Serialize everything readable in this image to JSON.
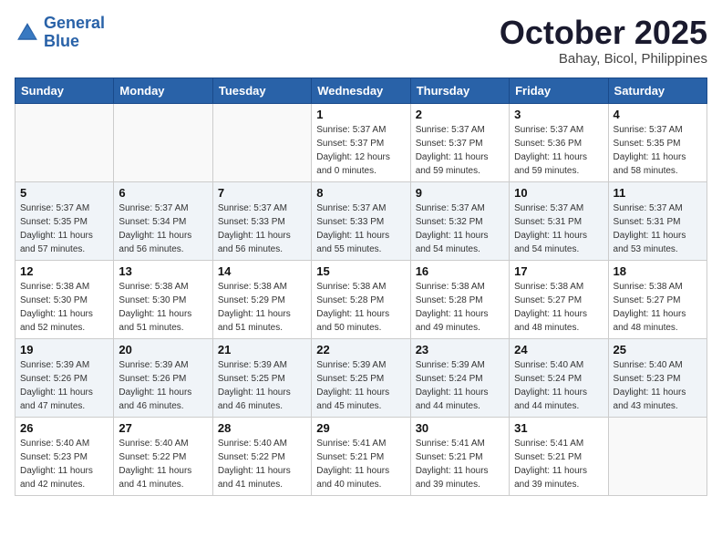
{
  "header": {
    "logo_line1": "General",
    "logo_line2": "Blue",
    "month": "October 2025",
    "location": "Bahay, Bicol, Philippines"
  },
  "weekdays": [
    "Sunday",
    "Monday",
    "Tuesday",
    "Wednesday",
    "Thursday",
    "Friday",
    "Saturday"
  ],
  "weeks": [
    [
      {
        "day": "",
        "sunrise": "",
        "sunset": "",
        "daylight": ""
      },
      {
        "day": "",
        "sunrise": "",
        "sunset": "",
        "daylight": ""
      },
      {
        "day": "",
        "sunrise": "",
        "sunset": "",
        "daylight": ""
      },
      {
        "day": "1",
        "sunrise": "Sunrise: 5:37 AM",
        "sunset": "Sunset: 5:37 PM",
        "daylight": "Daylight: 12 hours and 0 minutes."
      },
      {
        "day": "2",
        "sunrise": "Sunrise: 5:37 AM",
        "sunset": "Sunset: 5:37 PM",
        "daylight": "Daylight: 11 hours and 59 minutes."
      },
      {
        "day": "3",
        "sunrise": "Sunrise: 5:37 AM",
        "sunset": "Sunset: 5:36 PM",
        "daylight": "Daylight: 11 hours and 59 minutes."
      },
      {
        "day": "4",
        "sunrise": "Sunrise: 5:37 AM",
        "sunset": "Sunset: 5:35 PM",
        "daylight": "Daylight: 11 hours and 58 minutes."
      }
    ],
    [
      {
        "day": "5",
        "sunrise": "Sunrise: 5:37 AM",
        "sunset": "Sunset: 5:35 PM",
        "daylight": "Daylight: 11 hours and 57 minutes."
      },
      {
        "day": "6",
        "sunrise": "Sunrise: 5:37 AM",
        "sunset": "Sunset: 5:34 PM",
        "daylight": "Daylight: 11 hours and 56 minutes."
      },
      {
        "day": "7",
        "sunrise": "Sunrise: 5:37 AM",
        "sunset": "Sunset: 5:33 PM",
        "daylight": "Daylight: 11 hours and 56 minutes."
      },
      {
        "day": "8",
        "sunrise": "Sunrise: 5:37 AM",
        "sunset": "Sunset: 5:33 PM",
        "daylight": "Daylight: 11 hours and 55 minutes."
      },
      {
        "day": "9",
        "sunrise": "Sunrise: 5:37 AM",
        "sunset": "Sunset: 5:32 PM",
        "daylight": "Daylight: 11 hours and 54 minutes."
      },
      {
        "day": "10",
        "sunrise": "Sunrise: 5:37 AM",
        "sunset": "Sunset: 5:31 PM",
        "daylight": "Daylight: 11 hours and 54 minutes."
      },
      {
        "day": "11",
        "sunrise": "Sunrise: 5:37 AM",
        "sunset": "Sunset: 5:31 PM",
        "daylight": "Daylight: 11 hours and 53 minutes."
      }
    ],
    [
      {
        "day": "12",
        "sunrise": "Sunrise: 5:38 AM",
        "sunset": "Sunset: 5:30 PM",
        "daylight": "Daylight: 11 hours and 52 minutes."
      },
      {
        "day": "13",
        "sunrise": "Sunrise: 5:38 AM",
        "sunset": "Sunset: 5:30 PM",
        "daylight": "Daylight: 11 hours and 51 minutes."
      },
      {
        "day": "14",
        "sunrise": "Sunrise: 5:38 AM",
        "sunset": "Sunset: 5:29 PM",
        "daylight": "Daylight: 11 hours and 51 minutes."
      },
      {
        "day": "15",
        "sunrise": "Sunrise: 5:38 AM",
        "sunset": "Sunset: 5:28 PM",
        "daylight": "Daylight: 11 hours and 50 minutes."
      },
      {
        "day": "16",
        "sunrise": "Sunrise: 5:38 AM",
        "sunset": "Sunset: 5:28 PM",
        "daylight": "Daylight: 11 hours and 49 minutes."
      },
      {
        "day": "17",
        "sunrise": "Sunrise: 5:38 AM",
        "sunset": "Sunset: 5:27 PM",
        "daylight": "Daylight: 11 hours and 48 minutes."
      },
      {
        "day": "18",
        "sunrise": "Sunrise: 5:38 AM",
        "sunset": "Sunset: 5:27 PM",
        "daylight": "Daylight: 11 hours and 48 minutes."
      }
    ],
    [
      {
        "day": "19",
        "sunrise": "Sunrise: 5:39 AM",
        "sunset": "Sunset: 5:26 PM",
        "daylight": "Daylight: 11 hours and 47 minutes."
      },
      {
        "day": "20",
        "sunrise": "Sunrise: 5:39 AM",
        "sunset": "Sunset: 5:26 PM",
        "daylight": "Daylight: 11 hours and 46 minutes."
      },
      {
        "day": "21",
        "sunrise": "Sunrise: 5:39 AM",
        "sunset": "Sunset: 5:25 PM",
        "daylight": "Daylight: 11 hours and 46 minutes."
      },
      {
        "day": "22",
        "sunrise": "Sunrise: 5:39 AM",
        "sunset": "Sunset: 5:25 PM",
        "daylight": "Daylight: 11 hours and 45 minutes."
      },
      {
        "day": "23",
        "sunrise": "Sunrise: 5:39 AM",
        "sunset": "Sunset: 5:24 PM",
        "daylight": "Daylight: 11 hours and 44 minutes."
      },
      {
        "day": "24",
        "sunrise": "Sunrise: 5:40 AM",
        "sunset": "Sunset: 5:24 PM",
        "daylight": "Daylight: 11 hours and 44 minutes."
      },
      {
        "day": "25",
        "sunrise": "Sunrise: 5:40 AM",
        "sunset": "Sunset: 5:23 PM",
        "daylight": "Daylight: 11 hours and 43 minutes."
      }
    ],
    [
      {
        "day": "26",
        "sunrise": "Sunrise: 5:40 AM",
        "sunset": "Sunset: 5:23 PM",
        "daylight": "Daylight: 11 hours and 42 minutes."
      },
      {
        "day": "27",
        "sunrise": "Sunrise: 5:40 AM",
        "sunset": "Sunset: 5:22 PM",
        "daylight": "Daylight: 11 hours and 41 minutes."
      },
      {
        "day": "28",
        "sunrise": "Sunrise: 5:40 AM",
        "sunset": "Sunset: 5:22 PM",
        "daylight": "Daylight: 11 hours and 41 minutes."
      },
      {
        "day": "29",
        "sunrise": "Sunrise: 5:41 AM",
        "sunset": "Sunset: 5:21 PM",
        "daylight": "Daylight: 11 hours and 40 minutes."
      },
      {
        "day": "30",
        "sunrise": "Sunrise: 5:41 AM",
        "sunset": "Sunset: 5:21 PM",
        "daylight": "Daylight: 11 hours and 39 minutes."
      },
      {
        "day": "31",
        "sunrise": "Sunrise: 5:41 AM",
        "sunset": "Sunset: 5:21 PM",
        "daylight": "Daylight: 11 hours and 39 minutes."
      },
      {
        "day": "",
        "sunrise": "",
        "sunset": "",
        "daylight": ""
      }
    ]
  ]
}
